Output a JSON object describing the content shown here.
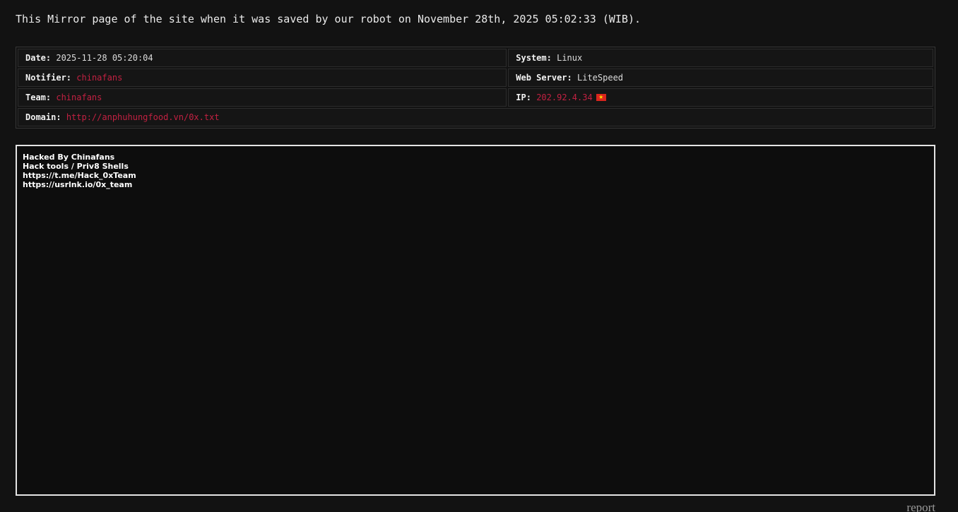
{
  "page": {
    "mirror_note": "This Mirror page of the site when it was saved by our robot on November 28th, 2025 05:02:33 (WIB).",
    "report_label": "report"
  },
  "info_table": {
    "date_label": "Date:",
    "date_value": "2025-11-28 05:20:04",
    "system_label": "System:",
    "system_value": "Linux",
    "notifier_label": "Notifier:",
    "notifier_value": "chinafans",
    "webserver_label": "Web Server:",
    "webserver_value": "LiteSpeed",
    "team_label": "Team:",
    "team_value": "chinafans",
    "ip_label": "IP:",
    "ip_value": "202.92.4.34",
    "ip_flag_glyph": "★",
    "domain_label": "Domain:",
    "domain_value": "http://anphuhungfood.vn/0x.txt"
  },
  "deface_content": {
    "lines": [
      "Hacked By Chinafans",
      "Hack tools / Priv8 Shells",
      "https://t.me/Hack_0xTeam",
      "https://usrlnk.io/0x_team"
    ]
  },
  "colors": {
    "accent_red": "#c32142",
    "flag_red": "#da251d",
    "flag_star_yellow": "#ffde00",
    "frame_border": "#e4e4e4",
    "page_background": "#121212"
  }
}
